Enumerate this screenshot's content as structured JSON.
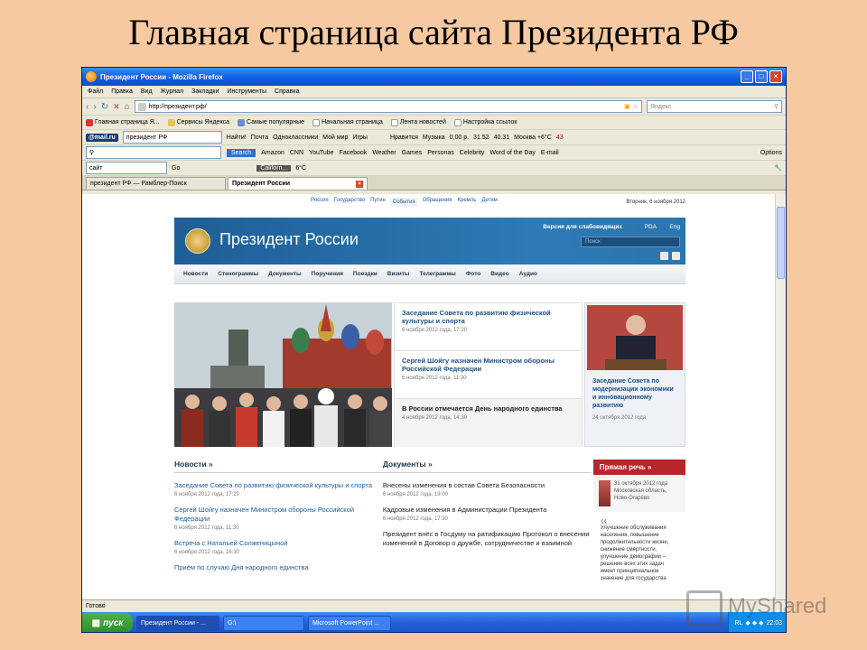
{
  "slide": {
    "title": "Главная страница сайта Президента РФ"
  },
  "window": {
    "title": "Президент России - Mozilla Firefox"
  },
  "menu": [
    "Файл",
    "Правка",
    "Вид",
    "Журнал",
    "Закладки",
    "Инструменты",
    "Справка"
  ],
  "navbar": {
    "url": "http://президент.рф/",
    "search_placeholder": "Яндекс"
  },
  "bookmarks": [
    "Главная страница Я...",
    "Сервисы Яндекса",
    "Самые популярные",
    "Начальная страница",
    "Лента новостей",
    "Настройка ссылок"
  ],
  "mailru_bar": {
    "logo": "@mail.ru",
    "query": "президент РФ",
    "find": "Найти!",
    "items": [
      "Почта",
      "Одноклассники",
      "Мой мир",
      "Игры",
      "Нравится",
      "Музыка",
      "0,00 р.",
      "31.52",
      "40.31",
      "Москва +6°C",
      "43"
    ]
  },
  "ask_bar": {
    "search_label": "Search",
    "items": [
      "Amazon",
      "CNN",
      "YouTube",
      "Facebook",
      "Weather",
      "Games",
      "Personas",
      "Celebrity",
      "Word of the Day",
      "E-mail",
      "Options"
    ]
  },
  "third_bar": {
    "query": "сайт",
    "go": "Go",
    "city": "Californ...",
    "temp": "6°C"
  },
  "tabs": [
    {
      "label": "президент РФ — Рамблер-Поиск"
    },
    {
      "label": "Президент России"
    }
  ],
  "site": {
    "topnav": [
      "Россия",
      "Государство",
      "Путин",
      "События",
      "Обращения",
      "Кремль",
      "Детям"
    ],
    "date": "Вторник, 6 ноября 2012",
    "name": "Президент России",
    "blind": "Версия для слабовидящих",
    "pda": "PDA",
    "eng": "Eng",
    "search": "Поиск",
    "mainnav": [
      "Новости",
      "Стенограммы",
      "Документы",
      "Поручения",
      "Поездки",
      "Визиты",
      "Телеграммы",
      "Фото",
      "Видео",
      "Аудио"
    ],
    "headlines": [
      {
        "title": "Заседание Совета по развитию физической культуры и спорта",
        "date": "6 ноября 2012 года, 17:20"
      },
      {
        "title": "Сергей Шойгу назначен Министром обороны Российской Федерации",
        "date": "6 ноября 2012 года, 11:30"
      },
      {
        "title": "В России отмечается День народного единства",
        "date": "4 ноября 2012 года, 14:30"
      }
    ],
    "side": {
      "title": "Заседание Совета по модернизации экономики и инновационному развитию",
      "date": "24 октября 2012 года"
    },
    "news": {
      "heading": "Новости »",
      "items": [
        {
          "title": "Заседание Совета по развитию физической культуры и спорта",
          "date": "6 ноября 2012 года, 17:20"
        },
        {
          "title": "Сергей Шойгу назначен Министром обороны Российской Федерации",
          "date": "6 ноября 2012 года, 11:30"
        },
        {
          "title": "Встреча с Натальей Солженицыной",
          "date": "6 ноября 2012 года, 16:30"
        },
        {
          "title": "Приём по случаю Дня народного единства",
          "date": ""
        }
      ]
    },
    "docs": {
      "heading": "Документы »",
      "items": [
        {
          "title": "Внесены изменения в состав Совета Безопасности",
          "date": "6 ноября 2012 года, 19:00"
        },
        {
          "title": "Кадровые изменения в Администрации Президента",
          "date": "6 ноября 2012 года, 17:30"
        },
        {
          "title": "Президент внёс в Госдуму на ратификацию Протокол о внесении изменений в Договор о дружбе, сотрудничестве и взаимной",
          "date": ""
        }
      ]
    },
    "speech": {
      "heading": "Прямая речь »",
      "meta": "31 октября 2012 года Московская область, Ново-Огарёво",
      "quote": "Улучшение обслуживания населения, повышение продолжительности жизни, снижение смертности, улучшение демографии – решение всех этих задач имеет принципиальное значение для государства"
    }
  },
  "status": "Готово",
  "taskbar": {
    "start": "пуск",
    "tasks": [
      "Президент России - ...",
      "G:\\",
      "Microsoft PowerPoint ..."
    ],
    "lang": "RL",
    "clock": "22:03"
  },
  "watermark": "MyShared"
}
